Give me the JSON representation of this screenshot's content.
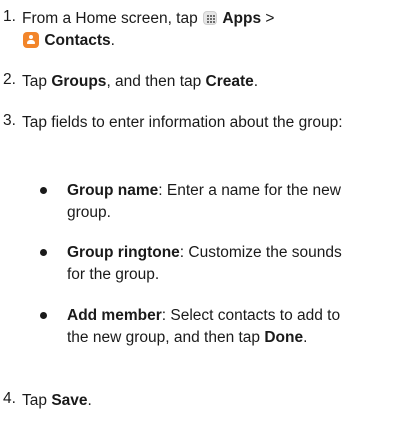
{
  "steps": [
    {
      "number": "1.",
      "text_before": "From a Home screen, tap ",
      "apps_label": "Apps",
      "separator": " >",
      "contacts_label": "Contacts",
      "period": "."
    },
    {
      "number": "2.",
      "text_before": "Tap ",
      "groups_label": "Groups",
      "middle": ", and then tap ",
      "create_label": "Create",
      "period": "."
    },
    {
      "number": "3.",
      "text": "Tap fields to enter information about the group:"
    },
    {
      "number": "4.",
      "text_before": "Tap ",
      "save_label": "Save",
      "period": "."
    }
  ],
  "bullets": [
    {
      "label": "Group name",
      "text": ": Enter a name for the new group."
    },
    {
      "label": "Group ringtone",
      "text": ": Customize the sounds for the group."
    },
    {
      "label": "Add member",
      "text": ": Select contacts to add to the new group, and then tap ",
      "done_label": "Done",
      "period": "."
    }
  ],
  "icons": {
    "apps": "apps-grid-icon",
    "contacts": "contacts-icon",
    "contacts_color": "#f2852a"
  }
}
